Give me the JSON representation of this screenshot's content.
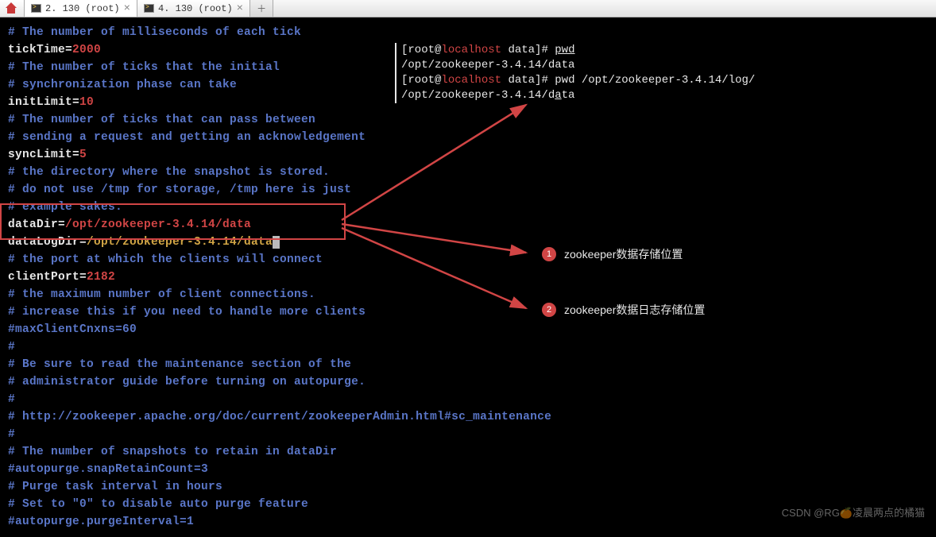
{
  "tabs": {
    "t1": "2. 130  (root)",
    "t2": "4. 130  (root)"
  },
  "config": {
    "l1": "# The number of milliseconds of each tick",
    "l2k": "tickTime=",
    "l2v": "2000",
    "l3": "# The number of ticks that the initial",
    "l4": "# synchronization phase can take",
    "l5k": "initLimit=",
    "l5v": "10",
    "l6": "# The number of ticks that can pass between",
    "l7": "# sending a request and getting an acknowledgement",
    "l8k": "syncLimit=",
    "l8v": "5",
    "l9": "# the directory where the snapshot is stored.",
    "l10": "# do not use /tmp for storage, /tmp here is just",
    "l11": "# example sakes.",
    "l12k": "dataDir=",
    "l12v": "/opt/zookeeper-3.4.14/data",
    "l13k": "dataLogDir=",
    "l13v": "/opt/zookeeper-3.4.14/data",
    "l14": "# the port at which the clients will connect",
    "l15k": "clientPort=",
    "l15v": "2182",
    "l16": "# the maximum number of client connections.",
    "l17": "# increase this if you need to handle more clients",
    "l18": "#maxClientCnxns=60",
    "l19": "#",
    "l20": "# Be sure to read the maintenance section of the",
    "l21": "# administrator guide before turning on autopurge.",
    "l22": "#",
    "l23": "# http://zookeeper.apache.org/doc/current/zookeeperAdmin.html#sc_maintenance",
    "l24": "#",
    "l25": "# The number of snapshots to retain in dataDir",
    "l26": "#autopurge.snapRetainCount=3",
    "l27": "# Purge task interval in hours",
    "l28": "# Set to \"0\" to disable auto purge feature",
    "l29": "#autopurge.purgeInterval=1"
  },
  "shell": {
    "lb": "[root@",
    "host": "localhost",
    "rb1": " data]# ",
    "cmd1": "pwd",
    "out1": "/opt/zookeeper-3.4.14/data",
    "cmd2": "pwd /opt/zookeeper-3.4.14/log/",
    "out2": "/opt/zookeeper-3.4.14/data"
  },
  "annotations": {
    "a1num": "1",
    "a1text": "zookeeper数据存储位置",
    "a2num": "2",
    "a2text": "zookeeper数据日志存储位置"
  },
  "watermark": "CSDN @RG🍊凌晨两点的橘猫"
}
